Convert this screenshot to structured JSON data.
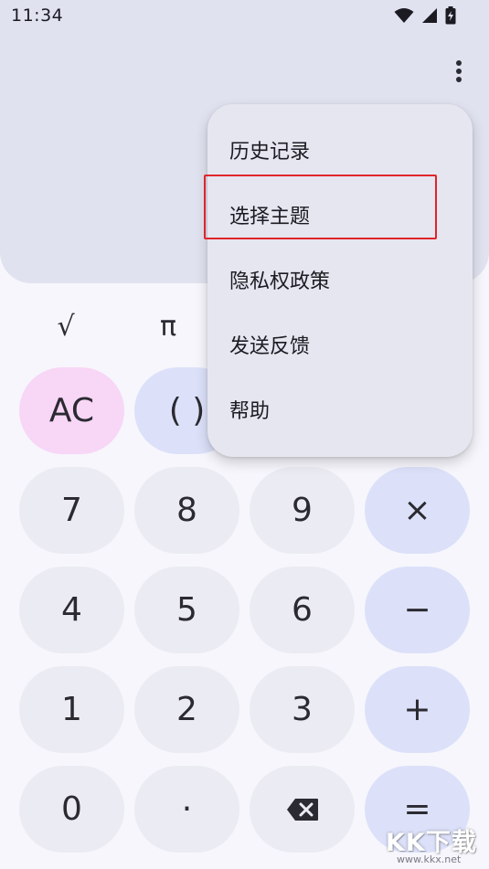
{
  "status_bar": {
    "time": "11:34"
  },
  "scientific_keys": {
    "sqrt": "√",
    "pi": "π"
  },
  "keypad": {
    "ac": "AC",
    "paren": "( )",
    "seven": "7",
    "eight": "8",
    "nine": "9",
    "multiply": "×",
    "four": "4",
    "five": "5",
    "six": "6",
    "minus": "−",
    "one": "1",
    "two": "2",
    "three": "3",
    "plus": "+",
    "zero": "0",
    "decimal": "·",
    "equals": "="
  },
  "menu": {
    "items": [
      "历史记录",
      "选择主题",
      "隐私权政策",
      "发送反馈",
      "帮助"
    ],
    "highlighted": "选择主题"
  },
  "watermark": {
    "text": "KK下载",
    "url": "www.kkx.net"
  },
  "colors": {
    "display_bg": "#e0e2f0",
    "menu_bg": "#e5e6ef",
    "ac_bg": "#f8d6f6",
    "operator_bg": "#dce1f9",
    "digit_bg": "#ebebf3",
    "highlight_border": "#e0252a"
  },
  "icons": {
    "status": [
      "wifi-icon",
      "signal-icon",
      "battery-charging-icon"
    ],
    "menu": "more-vert-icon",
    "backspace": "backspace-icon"
  }
}
